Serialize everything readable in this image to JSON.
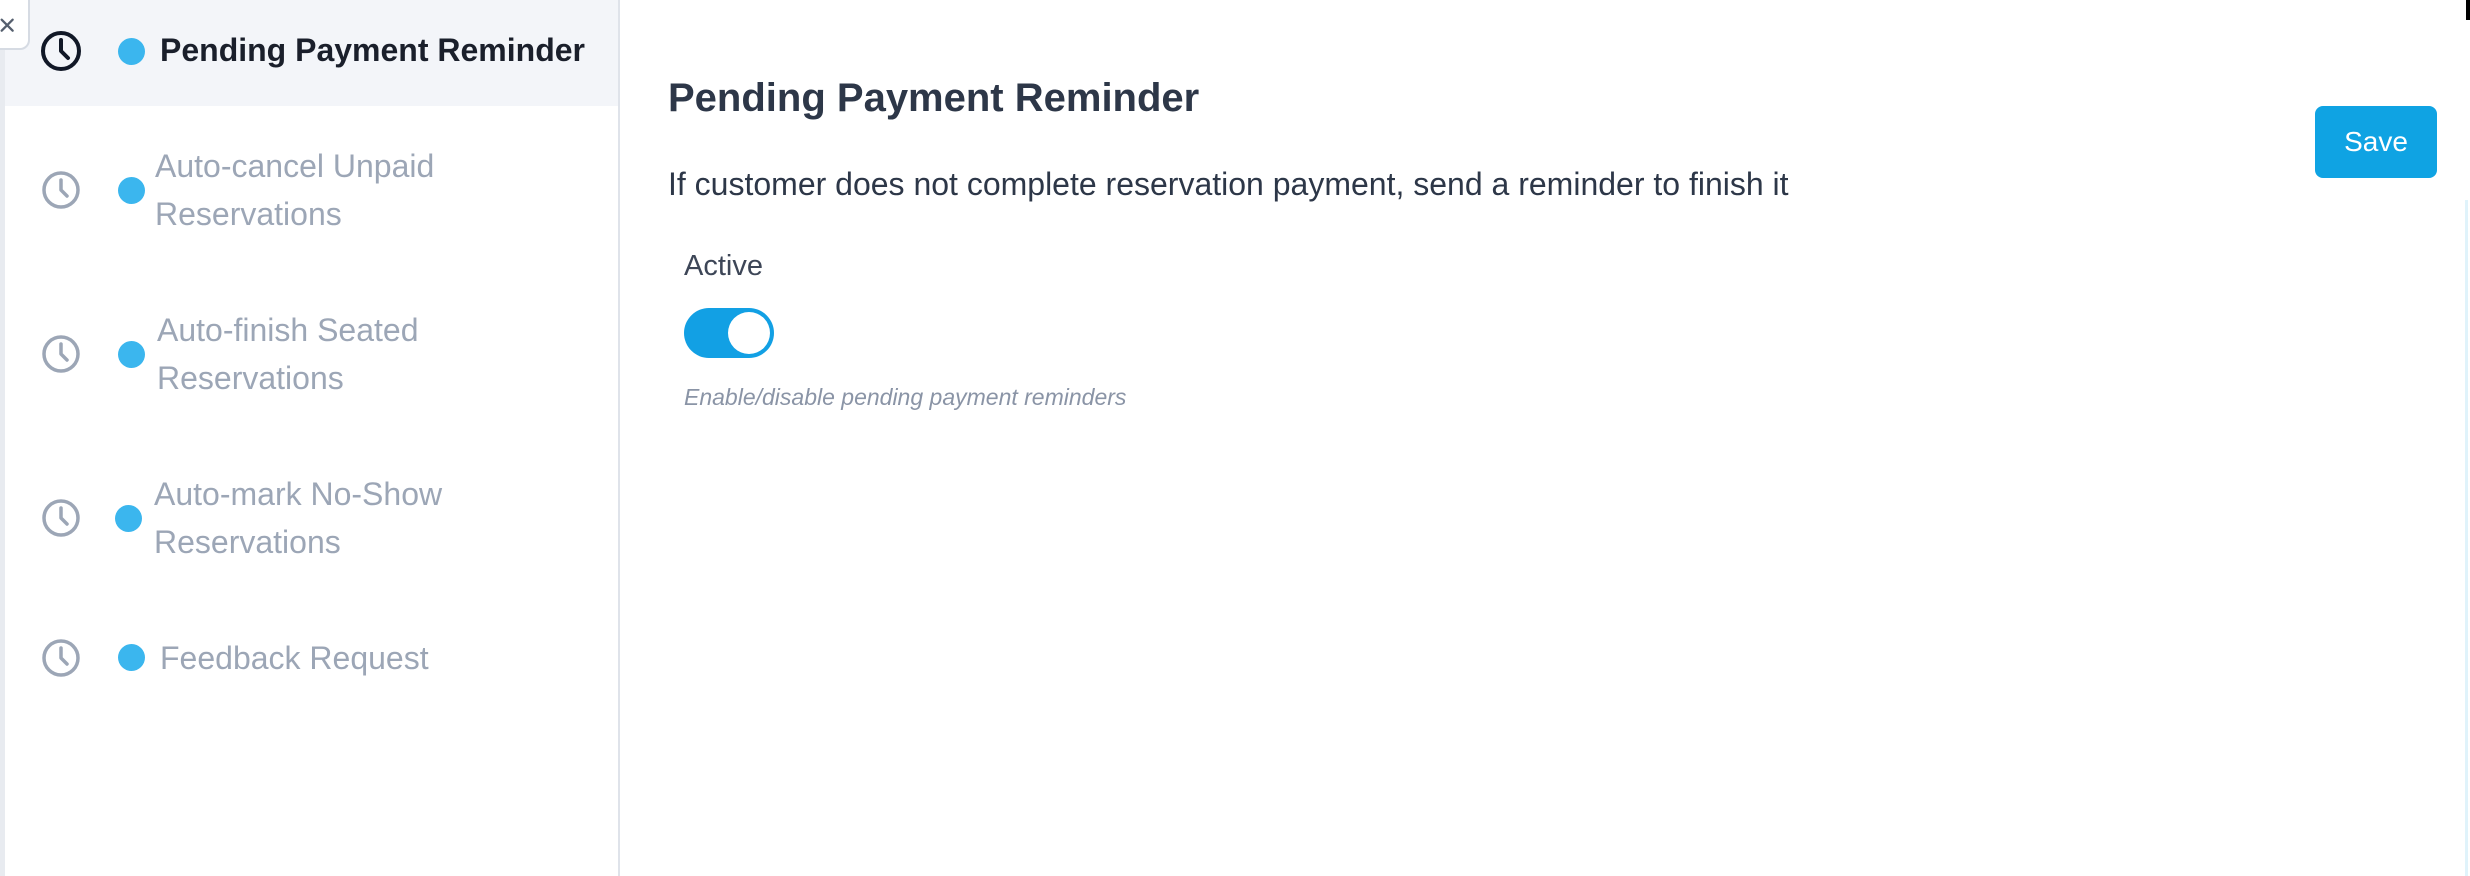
{
  "sidebar": {
    "back_icon": "close-icon",
    "items": [
      {
        "label": "Pending Payment Reminder",
        "icon": "clock-icon",
        "active": true
      },
      {
        "label": "Auto-cancel Unpaid Reservations",
        "icon": "clock-icon",
        "active": false
      },
      {
        "label": "Auto-finish Seated Reservations",
        "icon": "clock-icon",
        "active": false
      },
      {
        "label": "Auto-mark No-Show Reservations",
        "icon": "clock-icon",
        "active": false
      },
      {
        "label": "Feedback Request",
        "icon": "clock-icon",
        "active": false
      }
    ]
  },
  "main": {
    "title": "Pending Payment Reminder",
    "description": "If customer does not complete reservation payment, send a reminder to finish it",
    "active_label": "Active",
    "active_value": true,
    "help_text": "Enable/disable pending payment reminders",
    "save_label": "Save"
  },
  "colors": {
    "accent": "#0fa3e3",
    "dot": "#3bb6ee",
    "muted_text": "#9ca6b6",
    "active_bg": "#f3f5f9"
  }
}
